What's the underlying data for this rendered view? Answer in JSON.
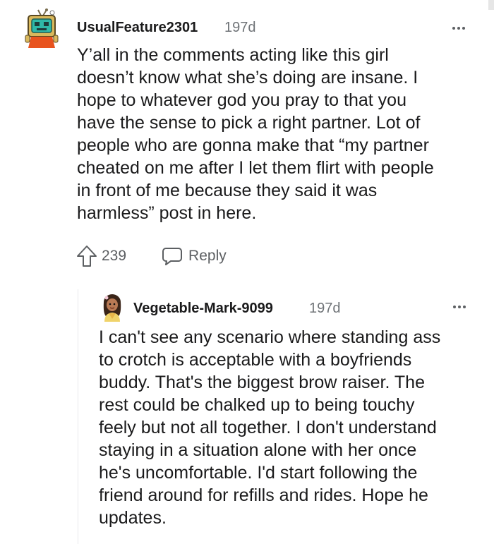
{
  "comments": [
    {
      "username": "UsualFeature2301",
      "age": "197d",
      "lines": [
        "Y’all in the comments acting like this girl",
        "doesn’t know what she’s doing are insane. I",
        "hope to whatever god you pray to that you",
        "have the sense to pick a right partner. Lot of",
        "people who are gonna make that “my partner",
        "cheated on me after I let them flirt with people",
        "in front of me because they said it was",
        "harmless” post in here."
      ],
      "votes": "239",
      "reply_label": "Reply",
      "avatar_icon": "tv-robot-avatar-icon"
    },
    {
      "username": "Vegetable-Mark-9099",
      "age": "197d",
      "lines": [
        "I can't see any scenario where standing ass",
        "to crotch is acceptable with a boyfriends",
        "buddy. That's the biggest brow raiser. The",
        "rest could be chalked up to being touchy",
        "feely but not all together. I don't understand",
        "staying in a situation alone with her once",
        "he's uncomfortable. I'd start following the",
        "friend around for refills and rides. Hope he",
        "updates."
      ],
      "avatar_icon": "girl-avatar-icon"
    }
  ],
  "colors": {
    "text": "#1a1a1b",
    "meta": "#6f7377",
    "action": "#5c5f62",
    "thread_line": "#e8eaeb"
  }
}
